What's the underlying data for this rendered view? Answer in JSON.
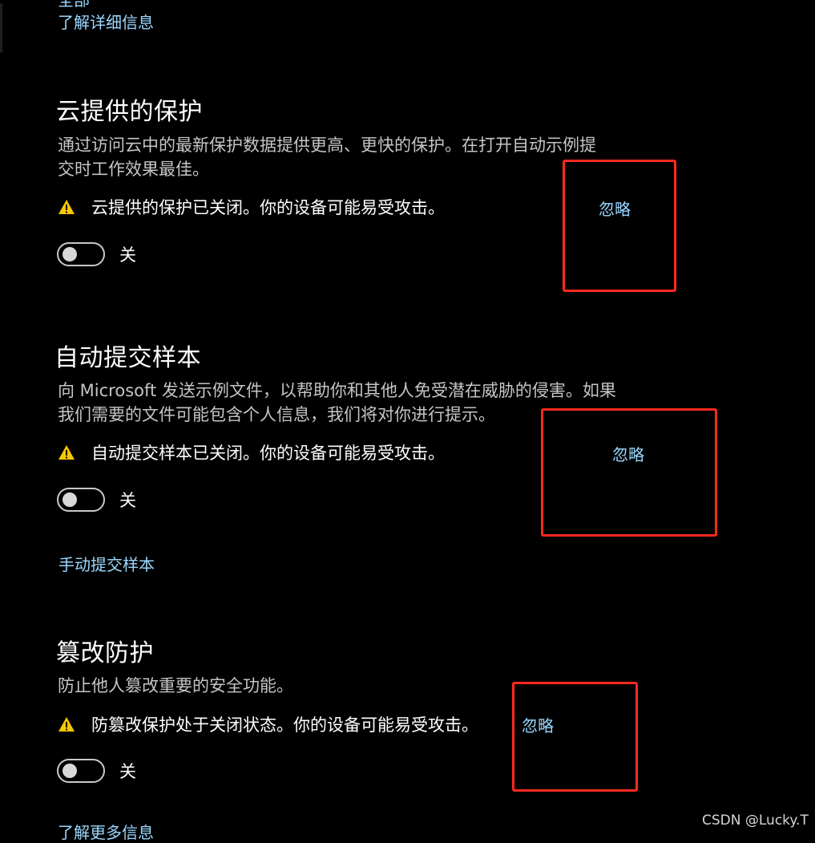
{
  "top": {
    "clipped_text": "全部",
    "learn_more": "了解详细信息"
  },
  "cloud_protection": {
    "title": "云提供的保护",
    "desc_line1": "通过访问云中的最新保护数据提供更高、更快的保护。在打开自动示例提",
    "desc_line2": "交时工作效果最佳。",
    "warning": "云提供的保护已关闭。你的设备可能易受攻击。",
    "ignore": "忽略",
    "toggle_state": "关",
    "toggle_on": false
  },
  "sample_submission": {
    "title": "自动提交样本",
    "desc_line1": "向 Microsoft 发送示例文件，以帮助你和其他人免受潜在威胁的侵害。如果",
    "desc_line2": "我们需要的文件可能包含个人信息，我们将对你进行提示。",
    "warning": "自动提交样本已关闭。你的设备可能易受攻击。",
    "ignore": "忽略",
    "toggle_state": "关",
    "toggle_on": false,
    "manual_link": "手动提交样本"
  },
  "tamper_protection": {
    "title": "篡改防护",
    "desc": "防止他人篡改重要的安全功能。",
    "warning": "防篡改保护处于关闭状态。你的设备可能易受攻击。",
    "ignore": "忽略",
    "toggle_state": "关",
    "toggle_on": false,
    "more_info": "了解更多信息"
  },
  "watermark": "CSDN @Lucky.T",
  "colors": {
    "background": "#000000",
    "link": "#9ad7ff",
    "warning_icon": "#f7c600",
    "annotation_box": "#ff2a1f",
    "description": "#c5c5c5"
  },
  "icons": {
    "warning": "warning-triangle-icon"
  }
}
